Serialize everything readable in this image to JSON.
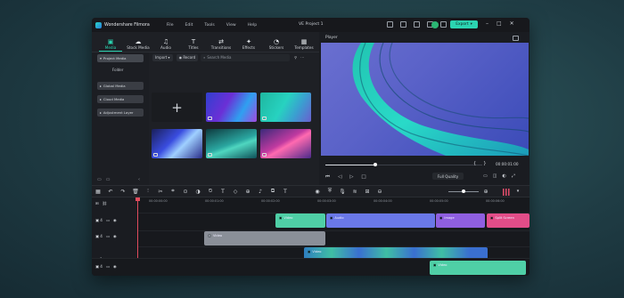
{
  "app": {
    "name": "Wondershare Filmora",
    "project_title": "VE Project 1",
    "menu": [
      "File",
      "Edit",
      "Tools",
      "View",
      "Help"
    ],
    "export_label": "Export",
    "accent": "#2bd4b1"
  },
  "toolbar": {
    "tabs": [
      {
        "label": "Media",
        "icon": "media-icon"
      },
      {
        "label": "Stock Media",
        "icon": "cloud-icon"
      },
      {
        "label": "Audio",
        "icon": "music-icon"
      },
      {
        "label": "Titles",
        "icon": "text-icon"
      },
      {
        "label": "Transitions",
        "icon": "transition-icon"
      },
      {
        "label": "Effects",
        "icon": "effects-icon"
      },
      {
        "label": "Stickers",
        "icon": "sticker-icon"
      },
      {
        "label": "Templates",
        "icon": "template-icon"
      }
    ]
  },
  "sidebar": {
    "items": [
      {
        "label": "Project Media",
        "active": true
      },
      {
        "label": "Folder"
      },
      {
        "label": "Global Media"
      },
      {
        "label": "Cloud Media"
      },
      {
        "label": "Adjustment Layer"
      }
    ]
  },
  "media": {
    "import_label": "Import",
    "record_label": "Record",
    "search_placeholder": "Search Media"
  },
  "player": {
    "label": "Player",
    "timecode": "00:00:01:00",
    "quality": "Full Quality",
    "progress": 0.32
  },
  "ruler": {
    "labels": [
      "00:00:00:00",
      "00:00:01:00",
      "00:00:02:00",
      "00:00:03:00",
      "00:00:04:00",
      "00:00:05:00",
      "00:00:06:00"
    ]
  },
  "tracks": [
    {
      "num": "4",
      "clips": [
        {
          "label": "Video",
          "color": "#4fcfa6"
        },
        {
          "label": "Audio",
          "color": "#6a78e8"
        },
        {
          "label": "Image",
          "color": "#8f5fe0"
        },
        {
          "label": "Split Screen",
          "color": "#e24d88"
        }
      ]
    },
    {
      "num": "4",
      "clips": [
        {
          "label": "Video",
          "color": "#8a8f98"
        }
      ]
    },
    {
      "num": "1",
      "clips": [
        {
          "label": "Video",
          "color": "#3fbfa4"
        }
      ]
    },
    {
      "num": "4",
      "clips": [
        {
          "label": "Video",
          "color": "#4fcfa6"
        }
      ]
    }
  ]
}
